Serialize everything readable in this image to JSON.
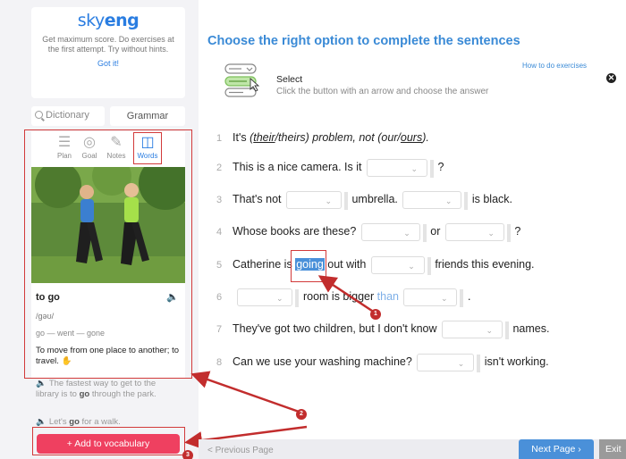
{
  "sidebar": {
    "logo": {
      "part1": "sky",
      "part2": "eng"
    },
    "hint": "Get maximum score. Do exercises at the first attempt. Try without hints.",
    "got_it": "Got it!",
    "dictionary_placeholder": "Dictionary",
    "grammar_tab": "Grammar",
    "tabs": [
      {
        "label": "Plan",
        "icon": "plan-icon"
      },
      {
        "label": "Goal",
        "icon": "goal-icon"
      },
      {
        "label": "Notes",
        "icon": "notes-icon"
      },
      {
        "label": "Words",
        "icon": "book-icon"
      }
    ],
    "word": "to go",
    "transcription": "/gəʊ/",
    "forms": "go — went — gone",
    "meaning": "To move from one place to another; to travel.",
    "examples": [
      {
        "before": "The fastest way to get to the library is to ",
        "bold": "go",
        "after": " through the park."
      },
      {
        "before": "Let's ",
        "bold": "go",
        "after": " for a walk."
      }
    ],
    "add_button": "+ Add to vocabulary"
  },
  "task": {
    "title": "Choose the right option to complete the sentences",
    "how_to": "How to do exercises",
    "select_title": "Select",
    "select_desc": "Click the button with an arrow and choose the answer"
  },
  "sentences": {
    "s1": {
      "num": "1",
      "a": "It's ",
      "b": "(",
      "c": "their",
      "d": "/theirs) problem, not ",
      "e": "(our/",
      "f": "ours",
      "g": ")."
    },
    "s2": {
      "num": "2",
      "a": "This is a nice camera. Is it",
      "b": "?"
    },
    "s3": {
      "num": "3",
      "a": "That's not",
      "b": "umbrella.",
      "c": "is black."
    },
    "s4": {
      "num": "4",
      "a": "Whose books are these?",
      "b": "or",
      "c": "?"
    },
    "s5": {
      "num": "5",
      "a": "Catherine is ",
      "b": "going",
      "c": " out with",
      "d": "friends this evening."
    },
    "s6": {
      "num": "6",
      "a": "room is bigger ",
      "b": "than",
      "c": "."
    },
    "s7": {
      "num": "7",
      "a": "They've got two children, but I don't know",
      "b": "names."
    },
    "s8": {
      "num": "8",
      "a": "Can we use your washing machine?",
      "b": "isn't working."
    }
  },
  "annotations": {
    "badge1": "1",
    "badge2": "2",
    "badge3": "3"
  },
  "footer": {
    "prev": "< Previous Page",
    "next": "Next Page ›",
    "exit": "Exit"
  },
  "colors": {
    "accent": "#2a7de1",
    "annotation_red": "#c22d2d",
    "add_button": "#ef4060"
  }
}
